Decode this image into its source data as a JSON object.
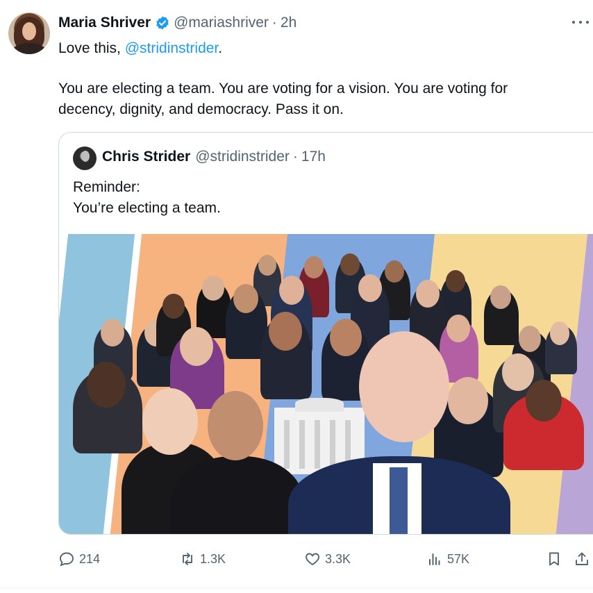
{
  "tweet": {
    "author_name": "Maria Shriver",
    "handle": "@mariashriver",
    "separator": "·",
    "time": "2h",
    "line1_prefix": "Love this, ",
    "line1_mention": "@stridinstrider",
    "line1_suffix": ".",
    "line2": "You are electing a team. You are voting for a vision. You are voting for",
    "line3": "decency, dignity, and democracy. Pass it on."
  },
  "quoted_tweet": {
    "author_name": "Chris Strider",
    "handle": "@stridinstrider",
    "separator": "·",
    "time": "17h",
    "line1": "Reminder:",
    "line2": "You’re electing a team."
  },
  "actions": {
    "replies": "214",
    "retweets": "1.3K",
    "likes": "3.3K",
    "views": "57K"
  },
  "colors": {
    "link": "#1d9bf0",
    "secondary_text": "#536471",
    "verified": "#1d9bf0",
    "stripe_blue_light": "#8fc3de",
    "stripe_orange": "#f6b37f",
    "stripe_blue": "#7fa7dd",
    "stripe_yellow": "#f7d996",
    "stripe_purple": "#b9a5d6"
  },
  "icons": {
    "verified": "verified-badge-icon",
    "more": "more-options-icon",
    "reply": "reply-icon",
    "retweet": "retweet-icon",
    "like": "heart-icon",
    "views": "views-chart-icon",
    "bookmark": "bookmark-icon",
    "share": "share-icon"
  }
}
